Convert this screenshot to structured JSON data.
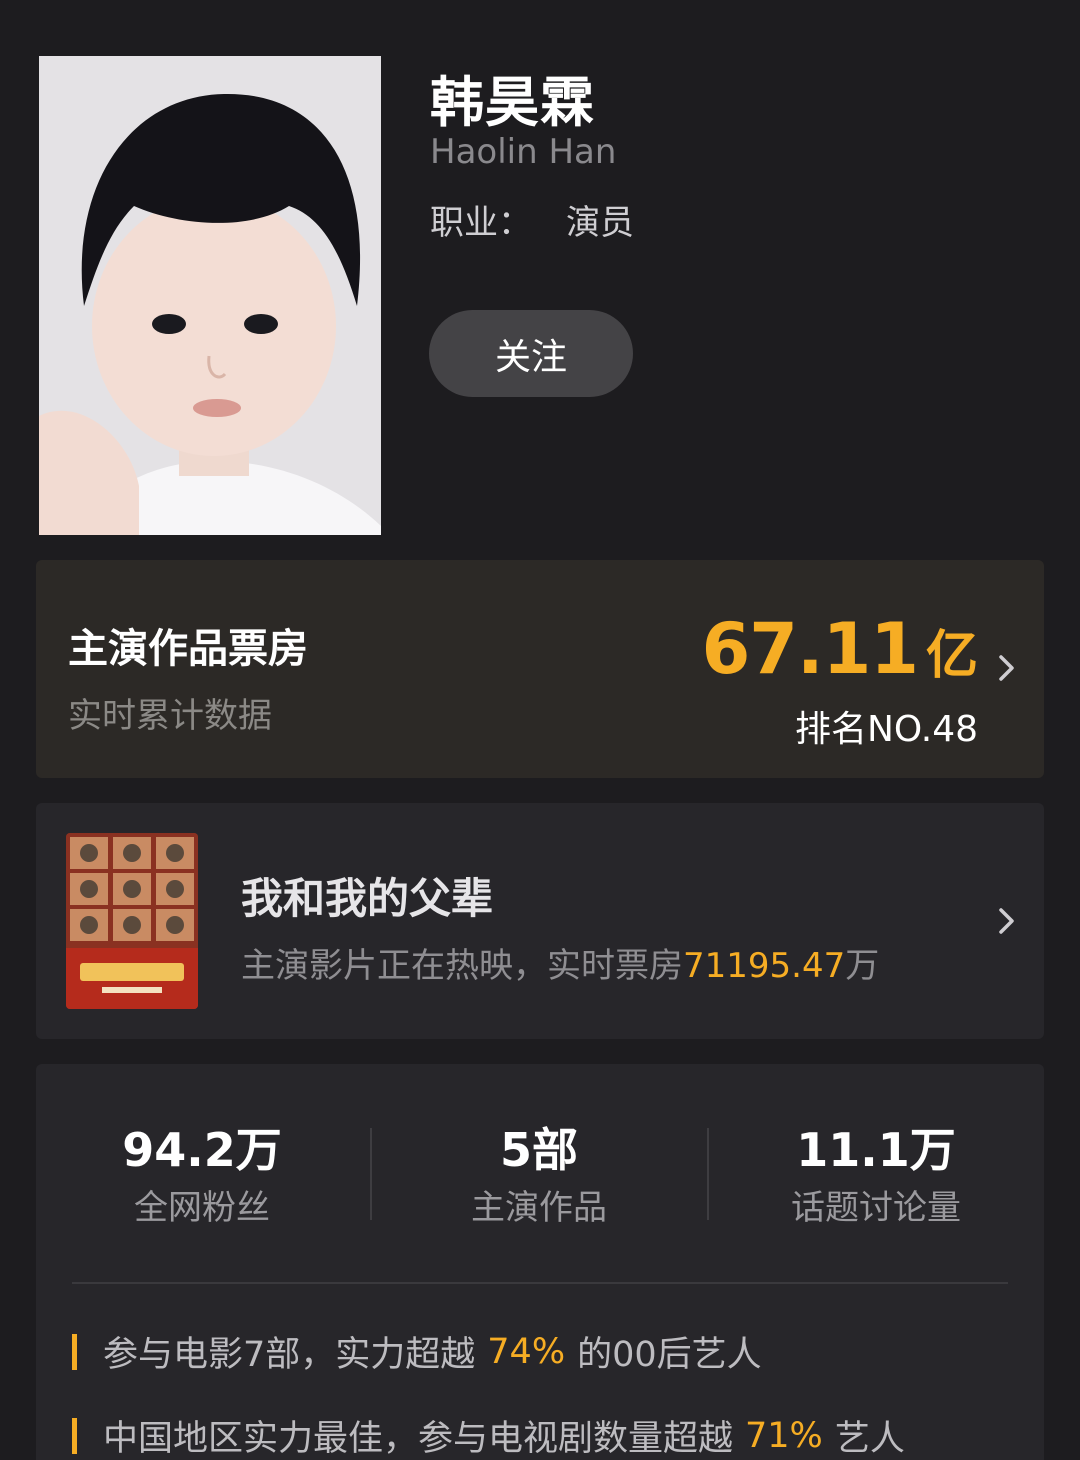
{
  "profile": {
    "name": "韩昊霖",
    "name_en": "Haolin Han",
    "job_label": "职业：",
    "job_value": "演员",
    "follow_label": "关注"
  },
  "box_office": {
    "title": "主演作品票房",
    "subtitle": "实时累计数据",
    "value": "67.11",
    "unit": "亿",
    "rank": "排名NO.48",
    "chevron_icon": "chevron-right-icon"
  },
  "now_playing": {
    "title": "我和我的父辈",
    "desc_prefix": "主演影片正在热映，实时票房",
    "desc_value": "71195.47",
    "desc_unit": "万",
    "chevron_icon": "chevron-right-icon"
  },
  "stats": [
    {
      "value": "94.2万",
      "label": "全网粉丝"
    },
    {
      "value": "5部",
      "label": "主演作品"
    },
    {
      "value": "11.1万",
      "label": "话题讨论量"
    }
  ],
  "insights": [
    {
      "prefix": "参与电影7部，实力超越",
      "pct": "74%",
      "suffix": "的00后艺人"
    },
    {
      "prefix": "中国地区实力最佳，参与电视剧数量超越",
      "pct": "71%",
      "suffix": "艺人"
    }
  ],
  "colors": {
    "background": "#1d1c1f",
    "accent": "#f6ad24",
    "box_office_card": "#2c2926",
    "card": "#27262a",
    "button": "#444346"
  }
}
